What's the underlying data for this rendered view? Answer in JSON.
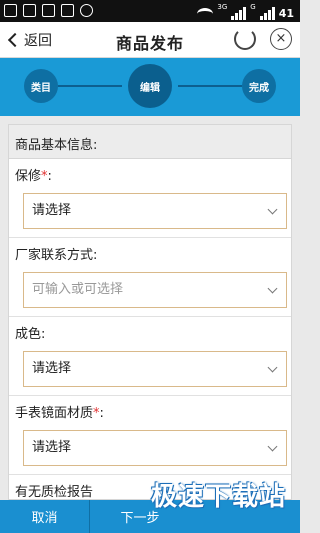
{
  "statusbar": {
    "network": "3G",
    "network2": "G",
    "battery": "41"
  },
  "header": {
    "back_label": "返回",
    "title": "商品发布"
  },
  "stepper": {
    "steps": [
      {
        "label": "类目"
      },
      {
        "label": "编辑"
      },
      {
        "label": "完成"
      }
    ],
    "current_step": 2
  },
  "form": {
    "section_title": "商品基本信息:",
    "fields": [
      {
        "label": "保修",
        "required_mark": "*",
        "colon": ":",
        "value": "请选择"
      },
      {
        "label": "厂家联系方式",
        "colon": ":",
        "placeholder": "可输入或可选择"
      },
      {
        "label": "成色",
        "colon": ":",
        "value": "请选择"
      },
      {
        "label": "手表镜面材质",
        "required_mark": "*",
        "colon": ":",
        "value": "请选择"
      },
      {
        "label": "有无质检报告"
      }
    ]
  },
  "bottombar": {
    "cancel_label": "取消",
    "next_label": "下一步"
  },
  "watermark": "极速下载站",
  "colors": {
    "accent": "#1a9ad6",
    "step_circle": "#0e6fa3",
    "required": "#e03030",
    "input_border": "#d9b98a"
  }
}
